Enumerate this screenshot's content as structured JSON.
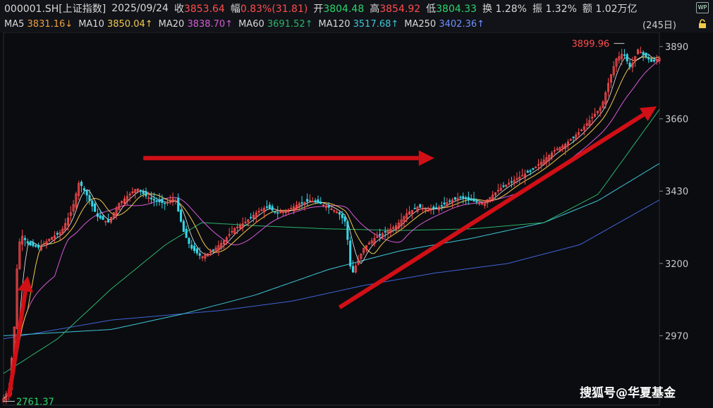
{
  "header": {
    "code": "000001.SH[上证指数]",
    "date": "2025/09/24",
    "close_label": "收",
    "close": "3853.64",
    "change_label": "幅",
    "change": "0.83%(31.81)",
    "open_label": "开",
    "open": "3804.48",
    "high_label": "高",
    "high": "3854.92",
    "low_label": "低",
    "low": "3804.33",
    "turnover_label": "换",
    "turnover": "1.28%",
    "amplitude_label": "振",
    "amplitude": "1.32%",
    "amount_label": "额",
    "amount": "1.02万亿",
    "wp_icon": "WP"
  },
  "ma_row": {
    "ma5": "MA5",
    "ma5_val": "3831.16↓",
    "ma10": "MA10",
    "ma10_val": "3850.04↑",
    "ma20": "MA20",
    "ma20_val": "3838.70↑",
    "ma60": "MA60",
    "ma60_val": "3691.52↑",
    "ma120": "MA120",
    "ma120_val": "3517.68↑",
    "ma250": "MA250",
    "ma250_val": "3402.36↑",
    "days": "(245日)"
  },
  "colors": {
    "up": "#ff4d4f",
    "down": "#35d6e6",
    "ma5": "#f0f0f0",
    "ma10": "#f2c94c",
    "ma20": "#d65ad6",
    "ma60": "#2bb56b",
    "ma120": "#3fc6d6",
    "ma250": "#3f63d6",
    "arrow": "#d10f16"
  },
  "chart_data": {
    "type": "candlestick",
    "title": "",
    "yticks": [
      2970,
      3200,
      3430,
      3660,
      3890
    ],
    "ylim": [
      2740,
      3935
    ],
    "sessions": 245,
    "high_label": "3899.96",
    "low_label": "2761.37",
    "high_value": 3899.96,
    "low_value": 2761.37,
    "last_close": 3853.64,
    "close_path": [
      [
        0,
        2770
      ],
      [
        3,
        2800
      ],
      [
        6,
        3000
      ],
      [
        8,
        3250
      ],
      [
        10,
        3290
      ],
      [
        14,
        3260
      ],
      [
        20,
        3250
      ],
      [
        26,
        3280
      ],
      [
        32,
        3300
      ],
      [
        38,
        3370
      ],
      [
        42,
        3460
      ],
      [
        46,
        3420
      ],
      [
        52,
        3350
      ],
      [
        58,
        3330
      ],
      [
        64,
        3390
      ],
      [
        70,
        3420
      ],
      [
        74,
        3440
      ],
      [
        80,
        3410
      ],
      [
        84,
        3400
      ],
      [
        90,
        3390
      ],
      [
        95,
        3410
      ],
      [
        100,
        3300
      ],
      [
        104,
        3250
      ],
      [
        110,
        3220
      ],
      [
        116,
        3240
      ],
      [
        122,
        3270
      ],
      [
        128,
        3310
      ],
      [
        134,
        3330
      ],
      [
        140,
        3360
      ],
      [
        146,
        3380
      ],
      [
        152,
        3360
      ],
      [
        158,
        3370
      ],
      [
        164,
        3390
      ],
      [
        170,
        3400
      ],
      [
        176,
        3390
      ],
      [
        180,
        3380
      ],
      [
        186,
        3360
      ],
      [
        190,
        3330
      ],
      [
        193,
        3160
      ],
      [
        196,
        3200
      ],
      [
        200,
        3250
      ],
      [
        206,
        3280
      ],
      [
        212,
        3300
      ],
      [
        218,
        3320
      ],
      [
        224,
        3360
      ],
      [
        230,
        3380
      ],
      [
        236,
        3370
      ],
      [
        242,
        3380
      ],
      [
        248,
        3400
      ],
      [
        254,
        3410
      ],
      [
        260,
        3400
      ],
      [
        266,
        3390
      ],
      [
        272,
        3420
      ],
      [
        276,
        3440
      ],
      [
        282,
        3460
      ],
      [
        288,
        3480
      ],
      [
        294,
        3500
      ],
      [
        300,
        3530
      ],
      [
        306,
        3560
      ],
      [
        312,
        3580
      ],
      [
        316,
        3600
      ],
      [
        320,
        3620
      ],
      [
        326,
        3660
      ],
      [
        332,
        3700
      ],
      [
        336,
        3780
      ],
      [
        340,
        3850
      ],
      [
        344,
        3870
      ],
      [
        348,
        3820
      ],
      [
        352,
        3880
      ],
      [
        356,
        3860
      ],
      [
        360,
        3840
      ],
      [
        364,
        3853.64
      ]
    ],
    "ma60_path": [
      [
        0,
        2850
      ],
      [
        30,
        2960
      ],
      [
        60,
        3120
      ],
      [
        90,
        3260
      ],
      [
        110,
        3330
      ],
      [
        140,
        3320
      ],
      [
        180,
        3310
      ],
      [
        220,
        3305
      ],
      [
        260,
        3310
      ],
      [
        300,
        3330
      ],
      [
        330,
        3420
      ],
      [
        364,
        3690
      ]
    ],
    "ma120_path": [
      [
        0,
        2970
      ],
      [
        60,
        2990
      ],
      [
        100,
        3040
      ],
      [
        140,
        3100
      ],
      [
        180,
        3180
      ],
      [
        220,
        3240
      ],
      [
        260,
        3280
      ],
      [
        300,
        3330
      ],
      [
        330,
        3400
      ],
      [
        364,
        3518
      ]
    ],
    "ma250_path": [
      [
        0,
        2960
      ],
      [
        60,
        3020
      ],
      [
        120,
        3050
      ],
      [
        160,
        3080
      ],
      [
        200,
        3130
      ],
      [
        240,
        3170
      ],
      [
        280,
        3200
      ],
      [
        320,
        3260
      ],
      [
        364,
        3402
      ]
    ]
  },
  "watermark": "搜狐号@华夏基金"
}
